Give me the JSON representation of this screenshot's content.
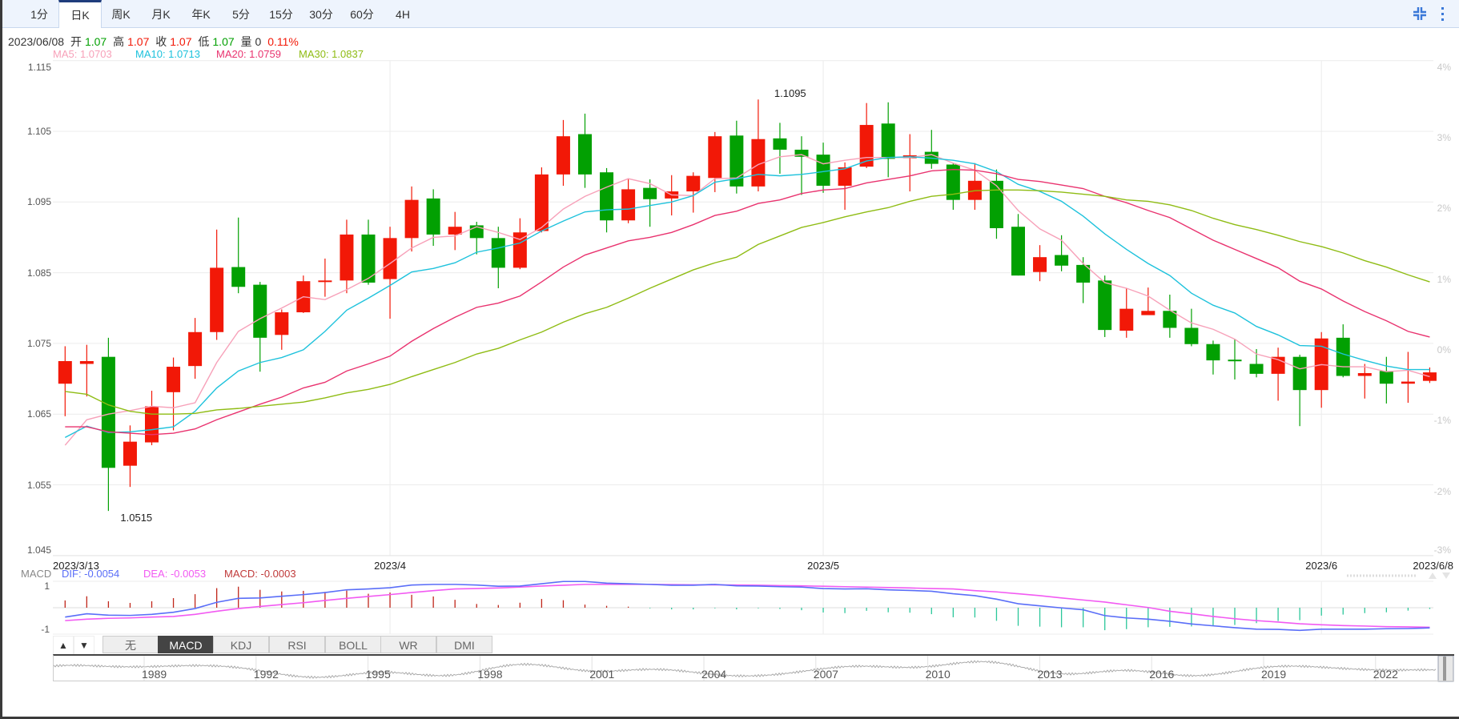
{
  "period_tabs": [
    {
      "label": "1分",
      "active": false
    },
    {
      "label": "日K",
      "active": true
    },
    {
      "label": "周K",
      "active": false
    },
    {
      "label": "月K",
      "active": false
    },
    {
      "label": "年K",
      "active": false
    },
    {
      "label": "5分",
      "active": false
    },
    {
      "label": "15分",
      "active": false
    },
    {
      "label": "30分",
      "active": false
    },
    {
      "label": "60分",
      "active": false
    },
    {
      "label": "4H",
      "active": false
    }
  ],
  "toolbar_icons": [
    "compress-icon",
    "more-vertical-icon"
  ],
  "info": {
    "date": "2023/06/08",
    "open_label": "开",
    "open": "1.07",
    "high_label": "高",
    "high": "1.07",
    "close_label": "收",
    "close": "1.07",
    "low_label": "低",
    "low": "1.07",
    "volume_label": "量",
    "volume": "0",
    "change": "0.11%"
  },
  "ma_legend": {
    "ma5": "MA5: 1.0703",
    "ma10": "MA10: 1.0713",
    "ma20": "MA20: 1.0759",
    "ma30": "MA30: 1.0837"
  },
  "colors": {
    "up": "#f21807",
    "down": "#02a002",
    "ma5": "#f7a1b9",
    "ma10": "#1ec2dc",
    "ma20": "#e9336f",
    "ma30": "#8fbc14",
    "dif": "#5a6ef8",
    "dea": "#f25af2",
    "macd_label": "#c03a3a",
    "hist_up": "#c0261a",
    "hist_down": "#2cc79a",
    "accent": "#1f3c7c"
  },
  "chart_data": {
    "type": "candlestick",
    "y_ticks": [
      "1.115",
      "1.105",
      "1.095",
      "1.085",
      "1.075",
      "1.065",
      "1.055",
      "1.045"
    ],
    "y_tick_values": [
      1.115,
      1.105,
      1.095,
      1.085,
      1.075,
      1.065,
      1.055,
      1.045
    ],
    "pct_ticks": [
      "4%",
      "3%",
      "2%",
      "1%",
      "0%",
      "-1%",
      "-2%",
      "-3%"
    ],
    "ylim": [
      1.045,
      1.115
    ],
    "x_ticks": [
      {
        "label": "2023/3/13",
        "index": 0
      },
      {
        "label": "2023/4",
        "index": 15
      },
      {
        "label": "2023/5",
        "index": 35
      },
      {
        "label": "2023/6",
        "index": 58
      },
      {
        "label": "2023/6/8",
        "index": 63
      }
    ],
    "annotations": {
      "max": {
        "label": "1.1095",
        "index": 32
      },
      "min": {
        "label": "1.0515",
        "index": 2
      }
    },
    "ohlc": [
      [
        1.0693,
        1.0746,
        1.0647,
        1.0725
      ],
      [
        1.0721,
        1.0748,
        1.0675,
        1.0725
      ],
      [
        1.0731,
        1.0758,
        1.0513,
        1.0574
      ],
      [
        1.0577,
        1.0634,
        1.0547,
        1.0611
      ],
      [
        1.061,
        1.0683,
        1.0606,
        1.0661
      ],
      [
        1.0681,
        1.073,
        1.0627,
        1.0717
      ],
      [
        1.0718,
        1.0786,
        1.07,
        1.0766
      ],
      [
        1.0766,
        1.0911,
        1.0755,
        1.0857
      ],
      [
        1.0858,
        1.0928,
        1.0821,
        1.083
      ],
      [
        1.0833,
        1.0837,
        1.071,
        1.0758
      ],
      [
        1.0762,
        1.0798,
        1.0741,
        1.0794
      ],
      [
        1.0794,
        1.0846,
        1.0793,
        1.0838
      ],
      [
        1.0839,
        1.087,
        1.0816,
        1.0839
      ],
      [
        1.0839,
        1.0925,
        1.0821,
        1.0904
      ],
      [
        1.0904,
        1.0925,
        1.0833,
        1.0836
      ],
      [
        1.0841,
        1.0915,
        1.0785,
        1.0899
      ],
      [
        1.0899,
        1.0972,
        1.088,
        1.0953
      ],
      [
        1.0955,
        1.0968,
        1.0888,
        1.0904
      ],
      [
        1.0904,
        1.0936,
        1.0882,
        1.0915
      ],
      [
        1.0917,
        1.0922,
        1.0876,
        1.0899
      ],
      [
        1.0899,
        1.0915,
        1.0828,
        1.0857
      ],
      [
        1.0857,
        1.0927,
        1.0855,
        1.0907
      ],
      [
        1.0909,
        1.0999,
        1.0907,
        1.0989
      ],
      [
        1.0989,
        1.1066,
        1.0973,
        1.1043
      ],
      [
        1.1046,
        1.1075,
        1.097,
        1.0989
      ],
      [
        1.0992,
        1.0998,
        1.0907,
        1.0924
      ],
      [
        1.0924,
        1.0982,
        1.092,
        1.0968
      ],
      [
        1.097,
        1.0982,
        1.0915,
        1.0954
      ],
      [
        1.0955,
        1.0988,
        1.0931,
        1.0965
      ],
      [
        1.0965,
        1.0992,
        1.0935,
        1.0987
      ],
      [
        1.0984,
        1.1049,
        1.0964,
        1.1043
      ],
      [
        1.1044,
        1.1065,
        1.0962,
        1.0972
      ],
      [
        1.0972,
        1.1095,
        1.0965,
        1.1039
      ],
      [
        1.104,
        1.1062,
        1.099,
        1.1024
      ],
      [
        1.1024,
        1.1043,
        1.096,
        1.1014
      ],
      [
        1.1017,
        1.1034,
        1.0963,
        1.0973
      ],
      [
        1.0973,
        1.1006,
        1.0939,
        1.0999
      ],
      [
        1.1,
        1.109,
        1.0998,
        1.1059
      ],
      [
        1.1061,
        1.1091,
        1.0985,
        1.1011
      ],
      [
        1.1012,
        1.1046,
        1.0965,
        1.1016
      ],
      [
        1.1021,
        1.1052,
        1.0997,
        1.1004
      ],
      [
        1.1003,
        1.1005,
        1.0939,
        1.0953
      ],
      [
        1.0953,
        1.1005,
        1.0939,
        1.098
      ],
      [
        1.098,
        1.0996,
        1.0898,
        1.0913
      ],
      [
        1.0915,
        1.0933,
        1.0846,
        1.0846
      ],
      [
        1.0851,
        1.0889,
        1.0838,
        1.0872
      ],
      [
        1.0875,
        1.0903,
        1.0852,
        1.086
      ],
      [
        1.0861,
        1.0872,
        1.0807,
        1.0836
      ],
      [
        1.0839,
        1.0846,
        1.0759,
        1.0769
      ],
      [
        1.0768,
        1.0828,
        1.0758,
        1.0799
      ],
      [
        1.079,
        1.0829,
        1.0793,
        1.0796
      ],
      [
        1.0796,
        1.0819,
        1.0758,
        1.0772
      ],
      [
        1.0772,
        1.0799,
        1.0746,
        1.0749
      ],
      [
        1.0749,
        1.0754,
        1.0706,
        1.0726
      ],
      [
        1.0727,
        1.0756,
        1.0699,
        1.0725
      ],
      [
        1.0721,
        1.0742,
        1.0702,
        1.0707
      ],
      [
        1.0707,
        1.0744,
        1.0669,
        1.0731
      ],
      [
        1.0731,
        1.0734,
        1.0633,
        1.0684
      ],
      [
        1.0684,
        1.0766,
        1.0659,
        1.0757
      ],
      [
        1.0758,
        1.0777,
        1.0702,
        1.0704
      ],
      [
        1.0704,
        1.0721,
        1.0672,
        1.0708
      ],
      [
        1.0711,
        1.0731,
        1.0665,
        1.0693
      ],
      [
        1.0693,
        1.0738,
        1.0666,
        1.0696
      ],
      [
        1.0697,
        1.0716,
        1.0694,
        1.0709
      ]
    ],
    "ma5": [
      1.0606,
      1.0642,
      1.065,
      1.0655,
      1.0661,
      1.0659,
      1.0666,
      1.0723,
      1.0767,
      1.0785,
      1.08,
      1.0816,
      1.0812,
      1.0826,
      1.0842,
      1.0863,
      1.0885,
      1.09,
      1.0902,
      1.0915,
      1.0907,
      1.0897,
      1.0914,
      1.094,
      1.0958,
      1.0971,
      1.0983,
      1.0976,
      1.096,
      1.0959,
      1.0983,
      1.0984,
      1.1003,
      1.1014,
      1.1017,
      1.1004,
      1.1009,
      1.1013,
      1.1013,
      1.1013,
      1.1017,
      1.1005,
      1.0995,
      1.0973,
      1.0938,
      1.0912,
      1.0896,
      1.0863,
      1.0836,
      1.0828,
      1.0817,
      1.0797,
      1.0779,
      1.077,
      1.0756,
      1.0735,
      1.0727,
      1.0714,
      1.072,
      1.0717,
      1.0717,
      1.071,
      1.0712,
      1.0703
    ],
    "ma10": [
      1.0617,
      1.0633,
      1.0624,
      1.0625,
      1.0628,
      1.0632,
      1.0654,
      1.0687,
      1.0711,
      1.0723,
      1.073,
      1.0741,
      1.0767,
      1.0797,
      1.0814,
      1.0832,
      1.0851,
      1.0856,
      1.0864,
      1.0879,
      1.0885,
      1.0892,
      1.0909,
      1.0923,
      1.0936,
      1.0939,
      1.094,
      1.0945,
      1.095,
      1.0959,
      1.0978,
      1.0983,
      1.0989,
      1.0987,
      1.0989,
      1.0993,
      1.0997,
      1.1008,
      1.1013,
      1.1014,
      1.1012,
      1.1009,
      1.1004,
      1.0993,
      1.0975,
      1.0965,
      1.0951,
      1.093,
      1.0905,
      1.0883,
      1.0863,
      1.0846,
      1.0821,
      1.0804,
      1.0793,
      1.0774,
      1.0762,
      1.0747,
      1.0746,
      1.0735,
      1.0726,
      1.0718,
      1.0713,
      1.0713
    ],
    "ma20": [
      1.0632,
      1.0632,
      1.0625,
      1.0623,
      1.0621,
      1.0623,
      1.0629,
      1.0642,
      1.0653,
      1.0664,
      1.0674,
      1.0687,
      1.0695,
      1.0711,
      1.0721,
      1.0732,
      1.0753,
      1.0771,
      1.0787,
      1.0801,
      1.0807,
      1.0817,
      1.0837,
      1.0858,
      1.0875,
      1.0885,
      1.0895,
      1.09,
      1.0907,
      1.0918,
      1.0931,
      1.0937,
      1.0948,
      1.0953,
      1.0962,
      1.0967,
      1.0969,
      1.0977,
      1.0982,
      1.0987,
      1.0994,
      1.0996,
      1.0995,
      1.099,
      1.0982,
      1.0979,
      1.0974,
      1.0969,
      1.0958,
      1.0949,
      1.0938,
      1.0928,
      1.0912,
      1.0896,
      1.0883,
      1.087,
      1.0857,
      1.0838,
      1.0827,
      1.081,
      1.0795,
      1.0782,
      1.0767,
      1.0759
    ],
    "ma30": [
      1.0682,
      1.0678,
      1.0663,
      1.0654,
      1.065,
      1.065,
      1.0651,
      1.0656,
      1.0658,
      1.0661,
      1.0664,
      1.0667,
      1.0673,
      1.068,
      1.0685,
      1.0692,
      1.0703,
      1.0713,
      1.0723,
      1.0735,
      1.0743,
      1.0755,
      1.0766,
      1.078,
      1.0792,
      1.0801,
      1.0814,
      1.0828,
      1.0841,
      1.0854,
      1.0864,
      1.0872,
      1.089,
      1.0902,
      1.0914,
      1.0921,
      1.0929,
      1.0936,
      1.0942,
      1.0951,
      1.0958,
      1.0961,
      1.0966,
      1.0967,
      1.0967,
      1.0966,
      1.0964,
      1.0961,
      1.0958,
      1.0953,
      1.0951,
      1.0946,
      1.0938,
      1.0927,
      1.0918,
      1.0911,
      1.0903,
      1.0894,
      1.0887,
      1.0878,
      1.0867,
      1.0858,
      1.0847,
      1.0837
    ],
    "macd": {
      "legend": {
        "name": "MACD",
        "dif": "DIF: -0.0054",
        "dea": "DEA: -0.0053",
        "macd": "MACD: -0.0003"
      },
      "y_ticks": [
        "1",
        "-1"
      ],
      "hist": [
        0.35,
        0.55,
        0.31,
        0.23,
        0.31,
        0.46,
        0.65,
        0.94,
        1.01,
        0.86,
        0.78,
        0.81,
        0.76,
        0.82,
        0.67,
        0.73,
        0.62,
        0.54,
        0.38,
        0.18,
        0.13,
        0.24,
        0.42,
        0.36,
        0.15,
        0.09,
        0.05,
        -0.03,
        -0.08,
        -0.08,
        -0.03,
        -0.08,
        -0.03,
        -0.06,
        -0.12,
        -0.23,
        -0.26,
        -0.15,
        -0.22,
        -0.24,
        -0.31,
        -0.46,
        -0.47,
        -0.63,
        -0.87,
        -0.91,
        -0.94,
        -0.94,
        -1.08,
        -1.03,
        -0.94,
        -0.92,
        -0.9,
        -0.87,
        -0.83,
        -0.74,
        -0.64,
        -0.6,
        -0.38,
        -0.33,
        -0.26,
        -0.22,
        -0.14,
        -0.06
      ],
      "dif": [
        -0.45,
        -0.29,
        -0.36,
        -0.37,
        -0.32,
        -0.22,
        -0.04,
        0.26,
        0.45,
        0.47,
        0.55,
        0.63,
        0.73,
        0.86,
        0.9,
        0.96,
        1.09,
        1.12,
        1.12,
        1.09,
        1.03,
        1.04,
        1.15,
        1.26,
        1.26,
        1.18,
        1.15,
        1.12,
        1.08,
        1.08,
        1.12,
        1.05,
        1.04,
        1.01,
        0.99,
        0.92,
        0.9,
        0.91,
        0.86,
        0.83,
        0.79,
        0.67,
        0.58,
        0.41,
        0.19,
        0.09,
        -0.01,
        -0.1,
        -0.38,
        -0.49,
        -0.55,
        -0.65,
        -0.78,
        -0.87,
        -0.96,
        -1.03,
        -1.04,
        -1.09,
        -1.03,
        -1.03,
        -1.03,
        -1.01,
        -1.0,
        -0.97
      ],
      "dea": [
        -0.62,
        -0.55,
        -0.51,
        -0.49,
        -0.45,
        -0.42,
        -0.32,
        -0.17,
        -0.04,
        0.06,
        0.15,
        0.24,
        0.35,
        0.45,
        0.54,
        0.63,
        0.73,
        0.82,
        0.9,
        0.92,
        0.95,
        0.99,
        1.04,
        1.08,
        1.12,
        1.12,
        1.12,
        1.12,
        1.11,
        1.1,
        1.1,
        1.09,
        1.08,
        1.06,
        1.05,
        1.03,
        1.01,
        0.99,
        0.97,
        0.95,
        0.92,
        0.9,
        0.82,
        0.76,
        0.67,
        0.58,
        0.47,
        0.37,
        0.27,
        0.14,
        0.01,
        -0.17,
        -0.29,
        -0.42,
        -0.53,
        -0.62,
        -0.69,
        -0.77,
        -0.82,
        -0.86,
        -0.88,
        -0.91,
        -0.92,
        -0.94
      ]
    }
  },
  "indicator_tabs": [
    {
      "label": "无",
      "active": false
    },
    {
      "label": "MACD",
      "active": true
    },
    {
      "label": "KDJ",
      "active": false
    },
    {
      "label": "RSI",
      "active": false
    },
    {
      "label": "BOLL",
      "active": false
    },
    {
      "label": "WR",
      "active": false
    },
    {
      "label": "DMI",
      "active": false
    }
  ],
  "indicator_arrows": {
    "up": "▲",
    "down": "▼"
  },
  "navigator": {
    "years": [
      "1989",
      "1992",
      "1995",
      "1998",
      "2001",
      "2004",
      "2007",
      "2010",
      "2013",
      "2016",
      "2019",
      "2022"
    ]
  }
}
